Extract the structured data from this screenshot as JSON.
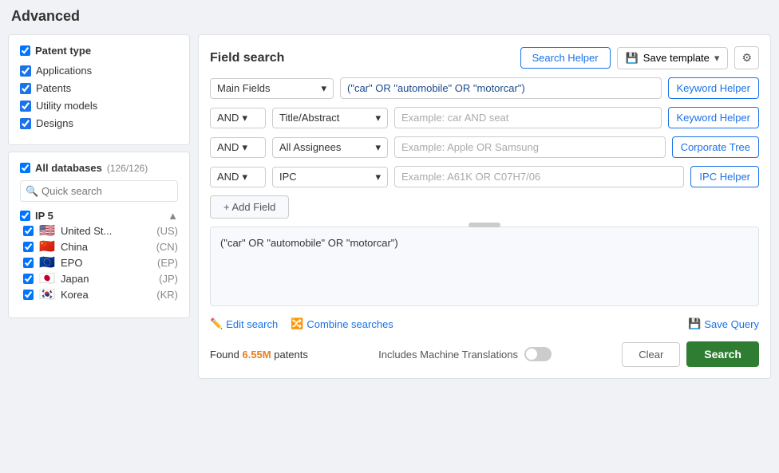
{
  "page": {
    "title": "Advanced"
  },
  "left": {
    "patent_type": {
      "label": "Patent type",
      "items": [
        {
          "id": "applications",
          "label": "Applications",
          "checked": true
        },
        {
          "id": "patents",
          "label": "Patents",
          "checked": true
        },
        {
          "id": "utility-models",
          "label": "Utility models",
          "checked": true
        },
        {
          "id": "designs",
          "label": "Designs",
          "checked": true
        }
      ]
    },
    "databases": {
      "label": "All databases",
      "count": "(126/126)",
      "search_placeholder": "Quick search",
      "groups": [
        {
          "id": "ip5",
          "label": "IP 5",
          "items": [
            {
              "id": "us",
              "label": "United St...",
              "code": "(US)",
              "flag": "🇺🇸"
            },
            {
              "id": "cn",
              "label": "China",
              "code": "(CN)",
              "flag": "🇨🇳"
            },
            {
              "id": "ep",
              "label": "EPO",
              "code": "(EP)",
              "flag": "🇪🇺"
            },
            {
              "id": "jp",
              "label": "Japan",
              "code": "(JP)",
              "flag": "🇯🇵"
            },
            {
              "id": "kr",
              "label": "Korea",
              "code": "(KR)",
              "flag": "🇰🇷"
            }
          ]
        }
      ]
    }
  },
  "right": {
    "title": "Field search",
    "buttons": {
      "search_helper": "Search Helper",
      "save_template": "Save template",
      "gear": "⚙"
    },
    "rows": [
      {
        "id": "row1",
        "operator": null,
        "field": "Main Fields",
        "value": "(\"car\" OR \"automobile\" OR \"motorcar\")",
        "placeholder": "",
        "helper_btn": "Keyword Helper"
      },
      {
        "id": "row2",
        "operator": "AND",
        "field": "Title/Abstract",
        "value": "",
        "placeholder": "Example: car AND seat",
        "helper_btn": "Keyword Helper"
      },
      {
        "id": "row3",
        "operator": "AND",
        "field": "All Assignees",
        "value": "",
        "placeholder": "Example: Apple OR Samsung",
        "helper_btn": "Corporate Tree"
      },
      {
        "id": "row4",
        "operator": "AND",
        "field": "IPC",
        "value": "",
        "placeholder": "Example: A61K OR C07H7/06",
        "helper_btn": "IPC Helper"
      }
    ],
    "add_field_label": "+ Add Field",
    "query_preview": "(\"car\" OR \"automobile\" OR \"motorcar\")",
    "bottom": {
      "edit_search": "Edit search",
      "combine_searches": "Combine searches",
      "save_query": "Save Query",
      "found_prefix": "Found ",
      "found_count": "6.55M",
      "found_suffix": " patents",
      "machine_translations": "Includes Machine Translations",
      "clear_label": "Clear",
      "search_label": "Search"
    }
  }
}
